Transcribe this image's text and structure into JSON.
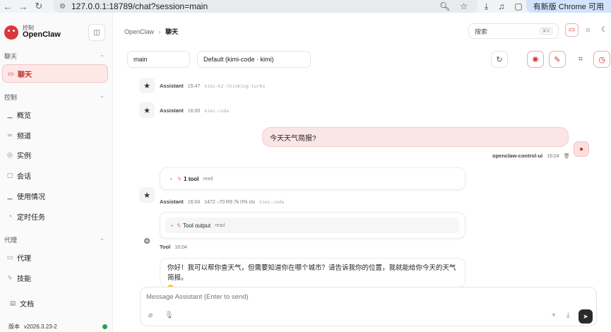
{
  "browser": {
    "url": "127.0.0.1:18789/chat?session=main",
    "update_label": "有新版 Chrome 可用"
  },
  "sidebar": {
    "brand_sub": "控制",
    "brand_name": "OpenClaw",
    "sections": [
      {
        "title": "聊天",
        "items": [
          {
            "label": "聊天",
            "icon": "chat-icon",
            "active": true
          }
        ]
      },
      {
        "title": "控制",
        "items": [
          {
            "label": "概览",
            "icon": "bar-chart-icon"
          },
          {
            "label": "频道",
            "icon": "link-icon"
          },
          {
            "label": "实例",
            "icon": "radio-icon"
          },
          {
            "label": "会话",
            "icon": "file-icon"
          },
          {
            "label": "使用情况",
            "icon": "bar-chart-icon"
          },
          {
            "label": "定时任务",
            "icon": "clock-icon"
          }
        ]
      },
      {
        "title": "代理",
        "items": [
          {
            "label": "代理",
            "icon": "folder-icon"
          },
          {
            "label": "技能",
            "icon": "zap-icon"
          }
        ]
      }
    ],
    "docs_label": "文档",
    "version_label": "版本",
    "version_value": "v2026.3.23-2",
    "status_color": "#22a34a"
  },
  "header": {
    "crumb_root": "OpenClaw",
    "crumb_sep": "›",
    "crumb_current": "聊天",
    "search_placeholder": "搜索",
    "search_shortcut": "⌘K"
  },
  "controls": {
    "session": "main",
    "model": "Default (kimi-code · kimi)"
  },
  "messages": {
    "m1": {
      "who": "Assistant",
      "time": "15:47",
      "model": "kimi-k2-thinking-turbo"
    },
    "m2": {
      "who": "Assistant",
      "time": "16:00",
      "model": "kimi-code"
    },
    "user": {
      "text": "今天天气简报?",
      "who": "openclaw-control-ui",
      "time": "16:04"
    },
    "tool_card": {
      "label": "1 tool",
      "sub": "read"
    },
    "m3": {
      "who": "Assistant",
      "time": "16:04",
      "stats": "1472 ↓70 R9.7k 0% ctx",
      "model": "kimi-code"
    },
    "tool_output": {
      "label": "Tool output",
      "sub": "read"
    },
    "tool": {
      "who": "Tool",
      "time": "16:04"
    },
    "reply": "你好！我可以帮你查天气，但需要知道你在哪个城市？请告诉我你的位置，我就能给你今天的天气简报。"
  },
  "composer": {
    "placeholder": "Message Assistant (Enter to send)"
  },
  "colors": {
    "accent": "#d32f2f",
    "active_bg": "#fde7e7"
  }
}
